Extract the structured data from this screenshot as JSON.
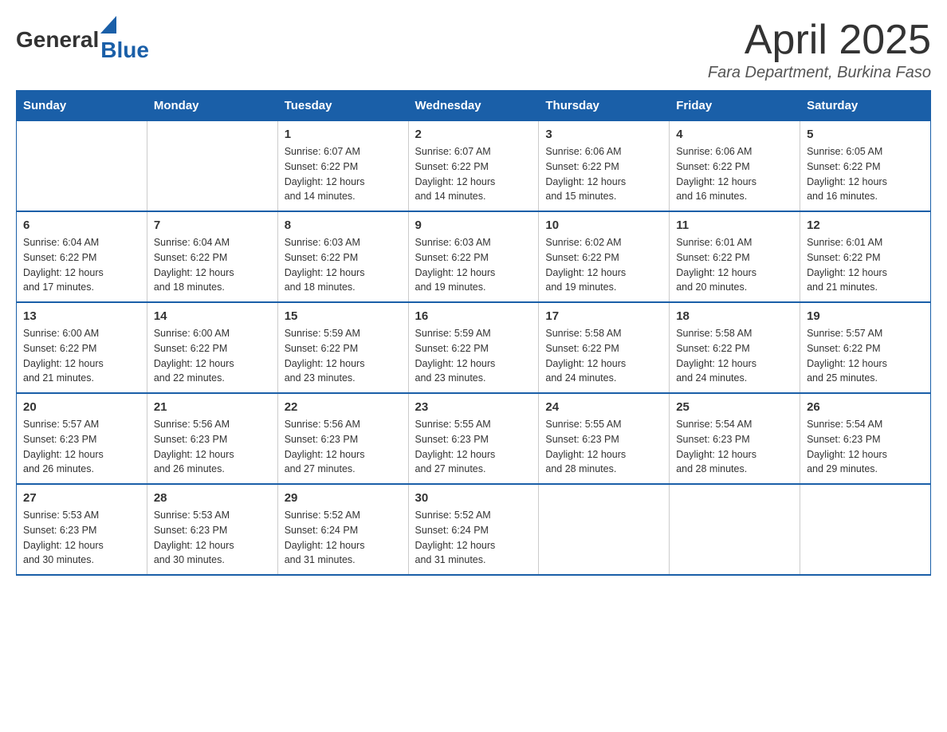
{
  "header": {
    "logo_general": "General",
    "logo_blue": "Blue",
    "title": "April 2025",
    "subtitle": "Fara Department, Burkina Faso"
  },
  "days_of_week": [
    "Sunday",
    "Monday",
    "Tuesday",
    "Wednesday",
    "Thursday",
    "Friday",
    "Saturday"
  ],
  "weeks": [
    [
      {
        "day": "",
        "info": ""
      },
      {
        "day": "",
        "info": ""
      },
      {
        "day": "1",
        "info": "Sunrise: 6:07 AM\nSunset: 6:22 PM\nDaylight: 12 hours\nand 14 minutes."
      },
      {
        "day": "2",
        "info": "Sunrise: 6:07 AM\nSunset: 6:22 PM\nDaylight: 12 hours\nand 14 minutes."
      },
      {
        "day": "3",
        "info": "Sunrise: 6:06 AM\nSunset: 6:22 PM\nDaylight: 12 hours\nand 15 minutes."
      },
      {
        "day": "4",
        "info": "Sunrise: 6:06 AM\nSunset: 6:22 PM\nDaylight: 12 hours\nand 16 minutes."
      },
      {
        "day": "5",
        "info": "Sunrise: 6:05 AM\nSunset: 6:22 PM\nDaylight: 12 hours\nand 16 minutes."
      }
    ],
    [
      {
        "day": "6",
        "info": "Sunrise: 6:04 AM\nSunset: 6:22 PM\nDaylight: 12 hours\nand 17 minutes."
      },
      {
        "day": "7",
        "info": "Sunrise: 6:04 AM\nSunset: 6:22 PM\nDaylight: 12 hours\nand 18 minutes."
      },
      {
        "day": "8",
        "info": "Sunrise: 6:03 AM\nSunset: 6:22 PM\nDaylight: 12 hours\nand 18 minutes."
      },
      {
        "day": "9",
        "info": "Sunrise: 6:03 AM\nSunset: 6:22 PM\nDaylight: 12 hours\nand 19 minutes."
      },
      {
        "day": "10",
        "info": "Sunrise: 6:02 AM\nSunset: 6:22 PM\nDaylight: 12 hours\nand 19 minutes."
      },
      {
        "day": "11",
        "info": "Sunrise: 6:01 AM\nSunset: 6:22 PM\nDaylight: 12 hours\nand 20 minutes."
      },
      {
        "day": "12",
        "info": "Sunrise: 6:01 AM\nSunset: 6:22 PM\nDaylight: 12 hours\nand 21 minutes."
      }
    ],
    [
      {
        "day": "13",
        "info": "Sunrise: 6:00 AM\nSunset: 6:22 PM\nDaylight: 12 hours\nand 21 minutes."
      },
      {
        "day": "14",
        "info": "Sunrise: 6:00 AM\nSunset: 6:22 PM\nDaylight: 12 hours\nand 22 minutes."
      },
      {
        "day": "15",
        "info": "Sunrise: 5:59 AM\nSunset: 6:22 PM\nDaylight: 12 hours\nand 23 minutes."
      },
      {
        "day": "16",
        "info": "Sunrise: 5:59 AM\nSunset: 6:22 PM\nDaylight: 12 hours\nand 23 minutes."
      },
      {
        "day": "17",
        "info": "Sunrise: 5:58 AM\nSunset: 6:22 PM\nDaylight: 12 hours\nand 24 minutes."
      },
      {
        "day": "18",
        "info": "Sunrise: 5:58 AM\nSunset: 6:22 PM\nDaylight: 12 hours\nand 24 minutes."
      },
      {
        "day": "19",
        "info": "Sunrise: 5:57 AM\nSunset: 6:22 PM\nDaylight: 12 hours\nand 25 minutes."
      }
    ],
    [
      {
        "day": "20",
        "info": "Sunrise: 5:57 AM\nSunset: 6:23 PM\nDaylight: 12 hours\nand 26 minutes."
      },
      {
        "day": "21",
        "info": "Sunrise: 5:56 AM\nSunset: 6:23 PM\nDaylight: 12 hours\nand 26 minutes."
      },
      {
        "day": "22",
        "info": "Sunrise: 5:56 AM\nSunset: 6:23 PM\nDaylight: 12 hours\nand 27 minutes."
      },
      {
        "day": "23",
        "info": "Sunrise: 5:55 AM\nSunset: 6:23 PM\nDaylight: 12 hours\nand 27 minutes."
      },
      {
        "day": "24",
        "info": "Sunrise: 5:55 AM\nSunset: 6:23 PM\nDaylight: 12 hours\nand 28 minutes."
      },
      {
        "day": "25",
        "info": "Sunrise: 5:54 AM\nSunset: 6:23 PM\nDaylight: 12 hours\nand 28 minutes."
      },
      {
        "day": "26",
        "info": "Sunrise: 5:54 AM\nSunset: 6:23 PM\nDaylight: 12 hours\nand 29 minutes."
      }
    ],
    [
      {
        "day": "27",
        "info": "Sunrise: 5:53 AM\nSunset: 6:23 PM\nDaylight: 12 hours\nand 30 minutes."
      },
      {
        "day": "28",
        "info": "Sunrise: 5:53 AM\nSunset: 6:23 PM\nDaylight: 12 hours\nand 30 minutes."
      },
      {
        "day": "29",
        "info": "Sunrise: 5:52 AM\nSunset: 6:24 PM\nDaylight: 12 hours\nand 31 minutes."
      },
      {
        "day": "30",
        "info": "Sunrise: 5:52 AM\nSunset: 6:24 PM\nDaylight: 12 hours\nand 31 minutes."
      },
      {
        "day": "",
        "info": ""
      },
      {
        "day": "",
        "info": ""
      },
      {
        "day": "",
        "info": ""
      }
    ]
  ]
}
